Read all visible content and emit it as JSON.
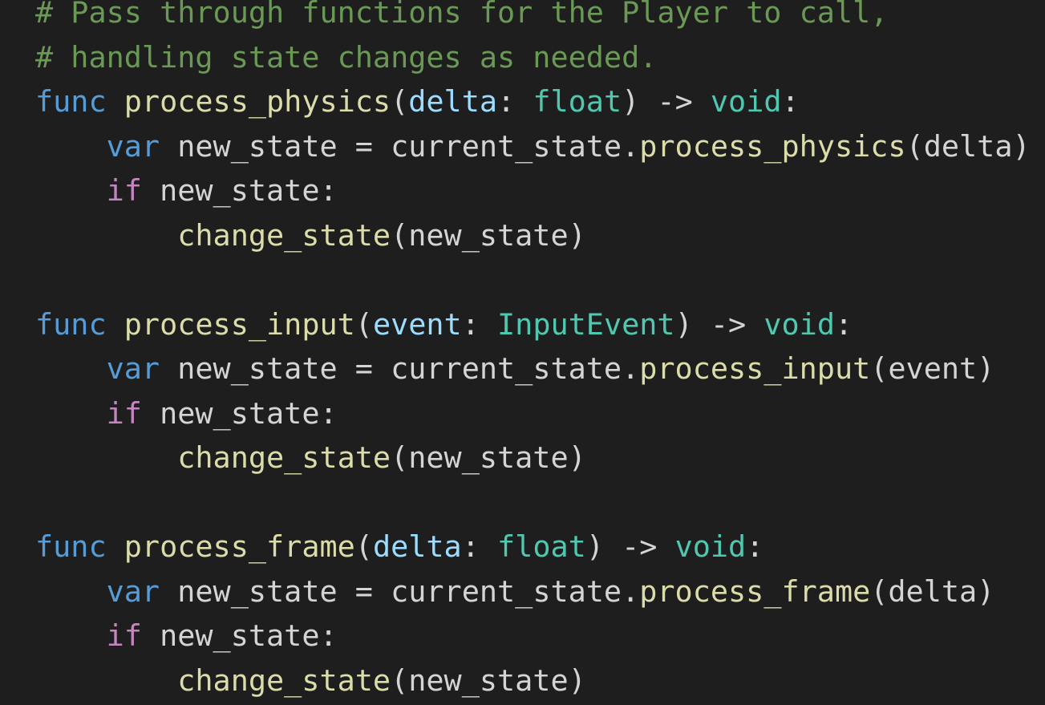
{
  "theme": {
    "background": "#1e1e1e",
    "colors": {
      "comment": "#6a9955",
      "keyword": "#569cd6",
      "control": "#c586c0",
      "function": "#dcdcaa",
      "param": "#9cdcfe",
      "type": "#4ec9b0",
      "plain": "#d4d4d4"
    }
  },
  "code": {
    "lines": [
      [
        {
          "t": "# Pass through functions for the Player to call,",
          "k": "comment"
        }
      ],
      [
        {
          "t": "# handling state changes as needed.",
          "k": "comment"
        }
      ],
      [
        {
          "t": "func",
          "k": "keyword"
        },
        {
          "t": " ",
          "k": "plain"
        },
        {
          "t": "process_physics",
          "k": "function"
        },
        {
          "t": "(",
          "k": "plain"
        },
        {
          "t": "delta",
          "k": "param"
        },
        {
          "t": ": ",
          "k": "plain"
        },
        {
          "t": "float",
          "k": "type"
        },
        {
          "t": ") -> ",
          "k": "plain"
        },
        {
          "t": "void",
          "k": "type"
        },
        {
          "t": ":",
          "k": "plain"
        }
      ],
      [
        {
          "t": "    ",
          "k": "plain"
        },
        {
          "t": "var",
          "k": "keyword"
        },
        {
          "t": " new_state = current_state.",
          "k": "plain"
        },
        {
          "t": "process_physics",
          "k": "function"
        },
        {
          "t": "(delta)",
          "k": "plain"
        }
      ],
      [
        {
          "t": "    ",
          "k": "plain"
        },
        {
          "t": "if",
          "k": "control"
        },
        {
          "t": " new_state:",
          "k": "plain"
        }
      ],
      [
        {
          "t": "        ",
          "k": "plain"
        },
        {
          "t": "change_state",
          "k": "function"
        },
        {
          "t": "(new_state)",
          "k": "plain"
        }
      ],
      [],
      [
        {
          "t": "func",
          "k": "keyword"
        },
        {
          "t": " ",
          "k": "plain"
        },
        {
          "t": "process_input",
          "k": "function"
        },
        {
          "t": "(",
          "k": "plain"
        },
        {
          "t": "event",
          "k": "param"
        },
        {
          "t": ": ",
          "k": "plain"
        },
        {
          "t": "InputEvent",
          "k": "type"
        },
        {
          "t": ") -> ",
          "k": "plain"
        },
        {
          "t": "void",
          "k": "type"
        },
        {
          "t": ":",
          "k": "plain"
        }
      ],
      [
        {
          "t": "    ",
          "k": "plain"
        },
        {
          "t": "var",
          "k": "keyword"
        },
        {
          "t": " new_state = current_state.",
          "k": "plain"
        },
        {
          "t": "process_input",
          "k": "function"
        },
        {
          "t": "(event)",
          "k": "plain"
        }
      ],
      [
        {
          "t": "    ",
          "k": "plain"
        },
        {
          "t": "if",
          "k": "control"
        },
        {
          "t": " new_state:",
          "k": "plain"
        }
      ],
      [
        {
          "t": "        ",
          "k": "plain"
        },
        {
          "t": "change_state",
          "k": "function"
        },
        {
          "t": "(new_state)",
          "k": "plain"
        }
      ],
      [],
      [
        {
          "t": "func",
          "k": "keyword"
        },
        {
          "t": " ",
          "k": "plain"
        },
        {
          "t": "process_frame",
          "k": "function"
        },
        {
          "t": "(",
          "k": "plain"
        },
        {
          "t": "delta",
          "k": "param"
        },
        {
          "t": ": ",
          "k": "plain"
        },
        {
          "t": "float",
          "k": "type"
        },
        {
          "t": ") -> ",
          "k": "plain"
        },
        {
          "t": "void",
          "k": "type"
        },
        {
          "t": ":",
          "k": "plain"
        }
      ],
      [
        {
          "t": "    ",
          "k": "plain"
        },
        {
          "t": "var",
          "k": "keyword"
        },
        {
          "t": " new_state = current_state.",
          "k": "plain"
        },
        {
          "t": "process_frame",
          "k": "function"
        },
        {
          "t": "(delta)",
          "k": "plain"
        }
      ],
      [
        {
          "t": "    ",
          "k": "plain"
        },
        {
          "t": "if",
          "k": "control"
        },
        {
          "t": " new_state:",
          "k": "plain"
        }
      ],
      [
        {
          "t": "        ",
          "k": "plain"
        },
        {
          "t": "change_state",
          "k": "function"
        },
        {
          "t": "(new_state)",
          "k": "plain"
        }
      ]
    ]
  }
}
